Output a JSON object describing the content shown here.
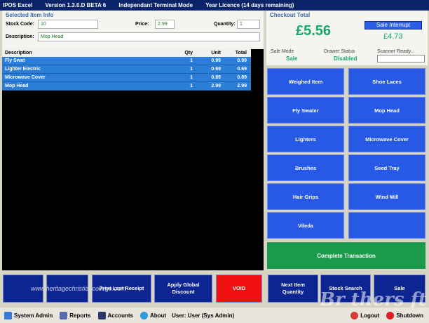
{
  "titlebar": {
    "app": "IPOS Excel",
    "version": "Version 1.3.0.D BETA 6",
    "mode": "Independant Terminal Mode",
    "licence": "Year Licence (14 days remaining)"
  },
  "item_info": {
    "title": "Selected Item Info",
    "stock_code_label": "Stock Code:",
    "stock_code": "10",
    "price_label": "Price:",
    "price": "2.99",
    "quantity_label": "Quantity:",
    "quantity": "1",
    "description_label": "Description:",
    "description": "Mop Head"
  },
  "grid": {
    "headers": [
      "Description",
      "Qty",
      "Unit",
      "Total"
    ],
    "rows": [
      {
        "desc": "Fly Swat",
        "qty": "1",
        "unit": "0.99",
        "total": "0.99"
      },
      {
        "desc": "Lighter Electric",
        "qty": "1",
        "unit": "0.69",
        "total": "0.69"
      },
      {
        "desc": "Microwave Cover",
        "qty": "1",
        "unit": "0.89",
        "total": "0.89"
      },
      {
        "desc": "Mop Head",
        "qty": "1",
        "unit": "2.99",
        "total": "2.99"
      }
    ]
  },
  "checkout": {
    "title": "Checkout Total",
    "total": "£5.56",
    "sale_interrupt": "Sale Interrupt",
    "subtotal": "£4.73",
    "sale_mode_label": "Sale Mode",
    "sale_mode": "Sale",
    "drawer_label": "Drawer Status",
    "drawer": "Disabled",
    "scanner_label": "Scanner Ready..."
  },
  "products": [
    "Weighed Item",
    "Shoe Laces",
    "Fly Swater",
    "Mop Head",
    "Lighters",
    "Microwave Cover",
    "Brushes",
    "Seed Tray",
    "Hair Grips",
    "Wind Mill",
    "Vileda",
    ""
  ],
  "complete": "Complete Transaction",
  "bottom": {
    "b1": "",
    "b2": "",
    "b3": "Print Last Receipt",
    "b4_line1": "Apply Global",
    "b4_line2": "Discount",
    "void": "VOID",
    "b6_line1": "Next Item",
    "b6_line2": "Quantity",
    "b7": "Stock Search",
    "b8": "Sale"
  },
  "watermark": "www.heritagechristiancollege.com",
  "watermark2": "Br thers ft",
  "status": {
    "system_admin": "System Admin",
    "reports": "Reports",
    "accounts": "Accounts",
    "about": "About",
    "user": "User: User (Sys Admin)",
    "logout": "Logout",
    "shutdown": "Shutdown"
  },
  "colors": {
    "title": "#0a246a",
    "accent_green": "#18a868",
    "button_blue": "#2859e6",
    "bottom_navy": "#0d2590",
    "void_red": "#f01010",
    "grid_row": "#2a7ed8"
  }
}
